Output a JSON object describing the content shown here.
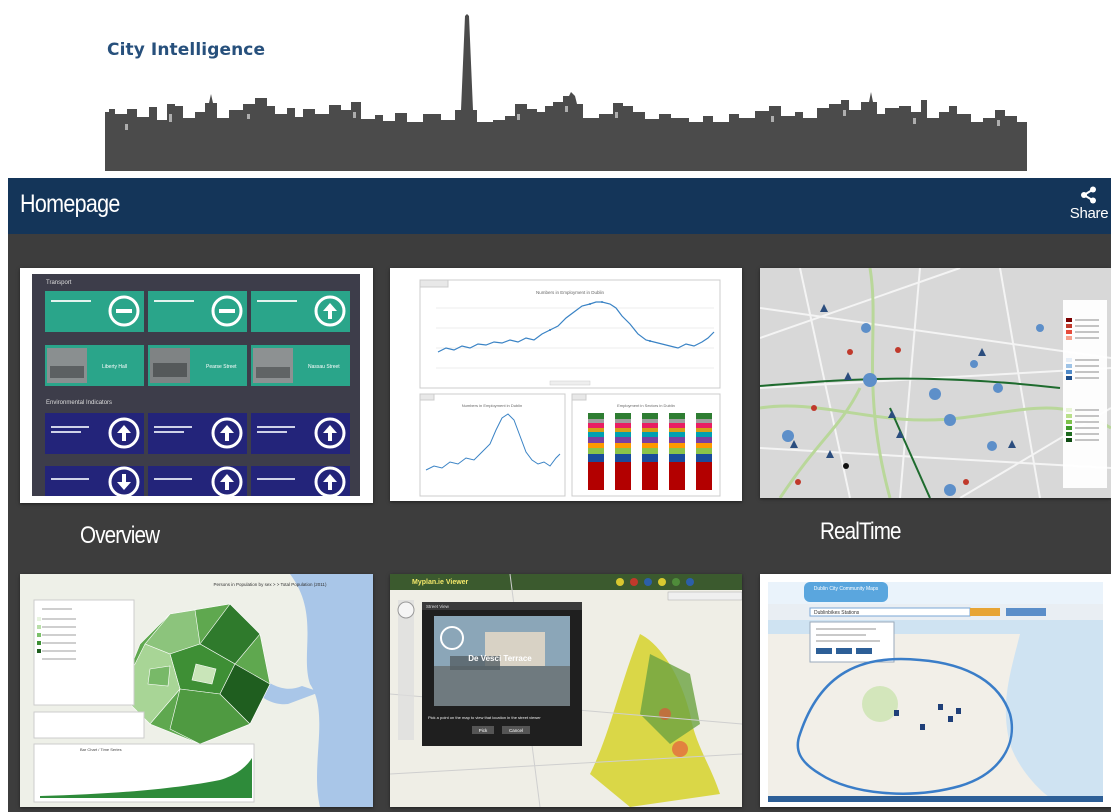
{
  "header": {
    "brand": "City Intelligence"
  },
  "titlebar": {
    "title": "Homepage",
    "share_label": "Share"
  },
  "tiles": [
    {
      "label": "Overview",
      "transport_heading": "Transport",
      "environment_heading": "Environmental Indicators",
      "traffic_cams": [
        "Liberty Hall",
        "Pearse Street",
        "Nassau Street"
      ]
    },
    {
      "label": "",
      "chart_top_title": "Numbers in Employment in Dublin",
      "chart_bl_title": "Numbers in Employment in Dublin",
      "chart_br_title": "Employment in Sectors in Dublin"
    },
    {
      "label": "RealTime"
    },
    {
      "label": "",
      "map_title": "Persons in Population by sex > > Total Population (2011)",
      "bar_chart_title": "Bar Chart / Time Series"
    },
    {
      "label": "",
      "app_title": "Myplan.ie Viewer",
      "popup_title": "Street View",
      "street_name": "De Vesci Terrace",
      "popup_hint": "Pick a point on the map to view that location in the street viewer",
      "btn_pick": "Pick",
      "btn_cancel": "Cancel"
    },
    {
      "label": "",
      "brand": "Dublin City Community Maps",
      "search_value": "Dublinbikes Stations"
    }
  ],
  "colors": {
    "titlebar": "#143559",
    "content_bg": "#3d3d3d",
    "brand_text": "#27507c",
    "teal_tile": "#2aa58a",
    "navy_tile": "#23247a"
  }
}
